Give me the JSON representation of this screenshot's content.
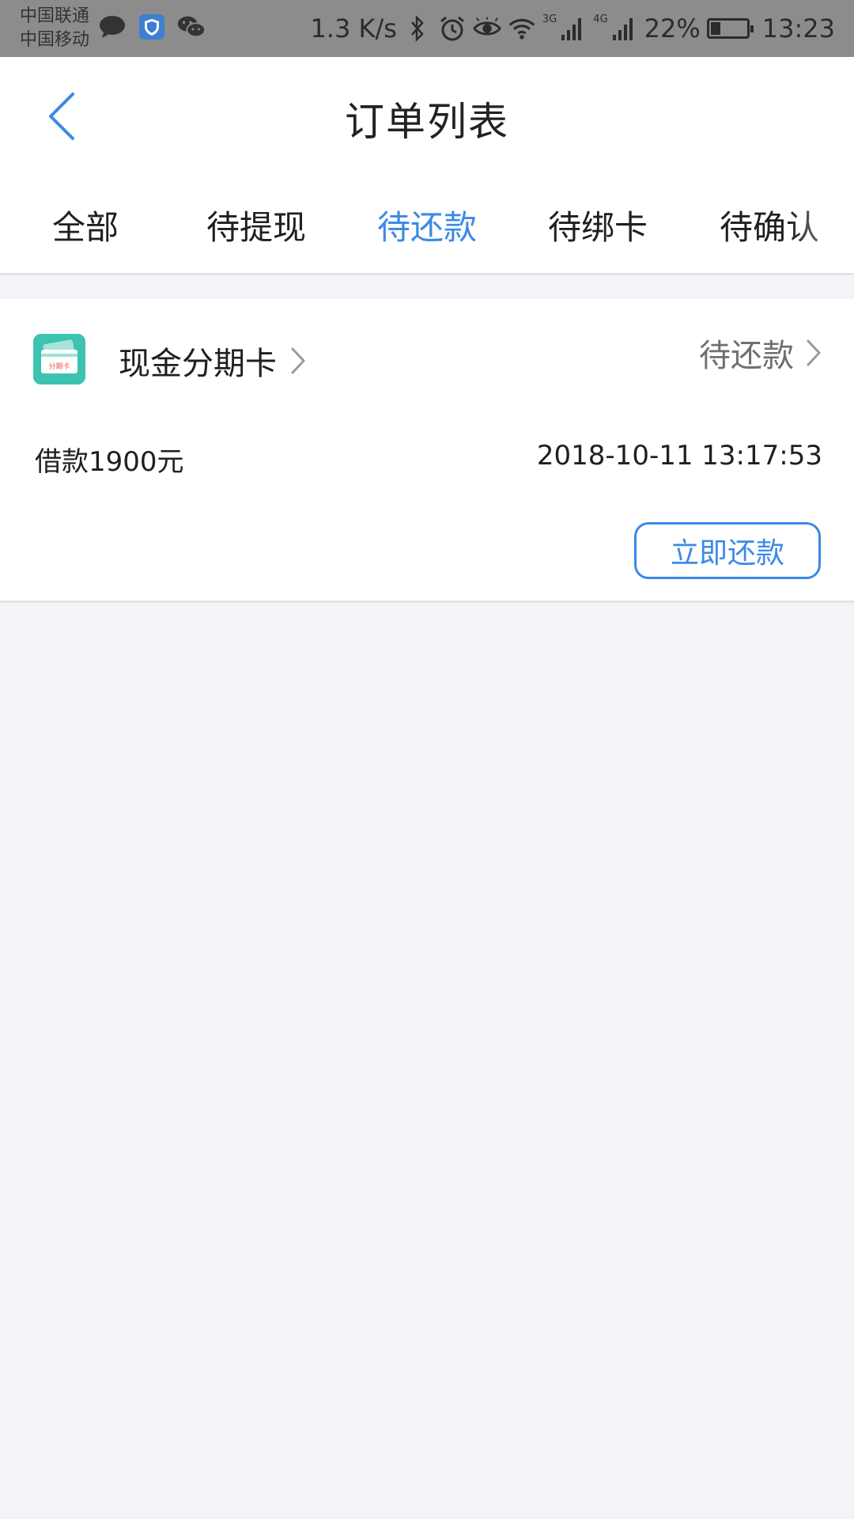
{
  "status_bar": {
    "carrier_1": "中国联通",
    "carrier_2": "中国移动",
    "speed": "1.3 K/s",
    "network_3g": "3G",
    "network_4g": "4G",
    "battery": "22%",
    "time": "13:23"
  },
  "header": {
    "title": "订单列表"
  },
  "tabs": [
    {
      "label": "全部"
    },
    {
      "label": "待提现"
    },
    {
      "label": "待还款"
    },
    {
      "label": "待绑卡"
    },
    {
      "label": "待确认"
    }
  ],
  "order": {
    "product_icon_text": "分期卡",
    "product_name": "现金分期卡",
    "status": "待还款",
    "loan": "借款1900元",
    "time": "2018-10-11 13:17:53",
    "action_label": "立即还款"
  },
  "colors": {
    "accent": "#3a8ae6",
    "product_icon": "#3dc3b0"
  }
}
